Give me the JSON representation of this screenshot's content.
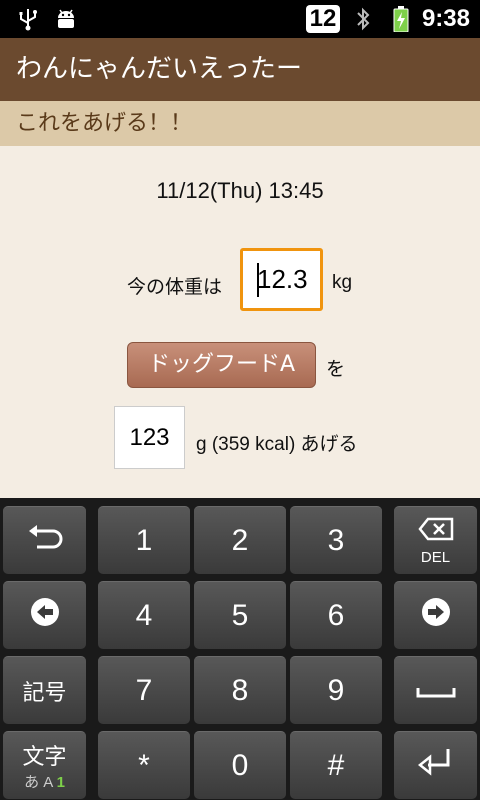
{
  "status_bar": {
    "notification_count": "12",
    "time": "9:38",
    "icons": [
      "usb-icon",
      "android-debug-icon",
      "bluetooth-icon",
      "battery-charging-icon"
    ]
  },
  "app": {
    "title": "わんにゃんだいえったー",
    "subheader": "これをあげる！！"
  },
  "form": {
    "datetime": "11/12(Thu) 13:45",
    "weight_label": "今の体重は",
    "weight_value": "12.3",
    "weight_unit": "kg",
    "food_button": "ドッグフードA",
    "food_particle": "を",
    "amount_value": "123",
    "amount_suffix": "g (359 kcal) あげる"
  },
  "keyboard": {
    "keys": {
      "k1": "1",
      "k2": "2",
      "k3": "3",
      "k4": "4",
      "k5": "5",
      "k6": "6",
      "k7": "7",
      "k8": "8",
      "k9": "9",
      "star": "*",
      "k0": "0",
      "hash": "#"
    },
    "del_label": "DEL",
    "symbols_label": "記号",
    "mode_label": "文字",
    "mode_sub": "あ A ",
    "mode_sub_num": "1"
  },
  "colors": {
    "title_bar": "#6b4a2f",
    "subheader": "#dcc9a8",
    "content_bg": "#f4ede3",
    "focus": "#f0940e",
    "food_button": "#b87a62"
  }
}
